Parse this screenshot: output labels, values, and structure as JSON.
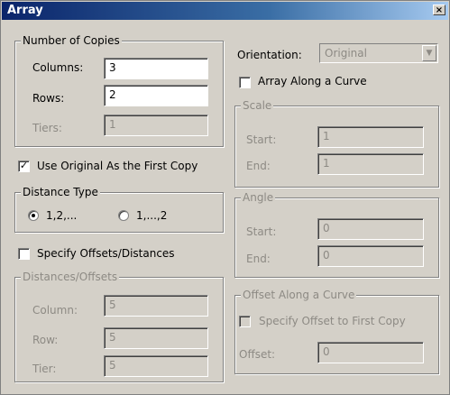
{
  "window": {
    "title": "Array",
    "close_label": "×"
  },
  "copies": {
    "legend": "Number of Copies",
    "columns_label": "Columns:",
    "columns_value": "3",
    "rows_label": "Rows:",
    "rows_value": "2",
    "tiers_label": "Tiers:",
    "tiers_value": "1"
  },
  "use_original": {
    "label": "Use Original As the First Copy",
    "checked": true
  },
  "distance_type": {
    "legend": "Distance Type",
    "option1": "1,2,...",
    "option2": "1,...,2",
    "selected": "option1"
  },
  "specify_offsets": {
    "label": "Specify Offsets/Distances",
    "checked": false
  },
  "distances": {
    "legend": "Distances/Offsets",
    "column_label": "Column:",
    "column_value": "5",
    "row_label": "Row:",
    "row_value": "5",
    "tier_label": "Tier:",
    "tier_value": "5"
  },
  "orientation": {
    "label": "Orientation:",
    "value": "Original"
  },
  "along_curve": {
    "label": "Array Along a Curve",
    "checked": false
  },
  "scale": {
    "legend": "Scale",
    "start_label": "Start:",
    "start_value": "1",
    "end_label": "End:",
    "end_value": "1"
  },
  "angle": {
    "legend": "Angle",
    "start_label": "Start:",
    "start_value": "0",
    "end_label": "End:",
    "end_value": "0"
  },
  "offset_curve": {
    "legend": "Offset Along a Curve",
    "specify_label": "Specify Offset to First Copy",
    "offset_label": "Offset:",
    "offset_value": "0"
  }
}
